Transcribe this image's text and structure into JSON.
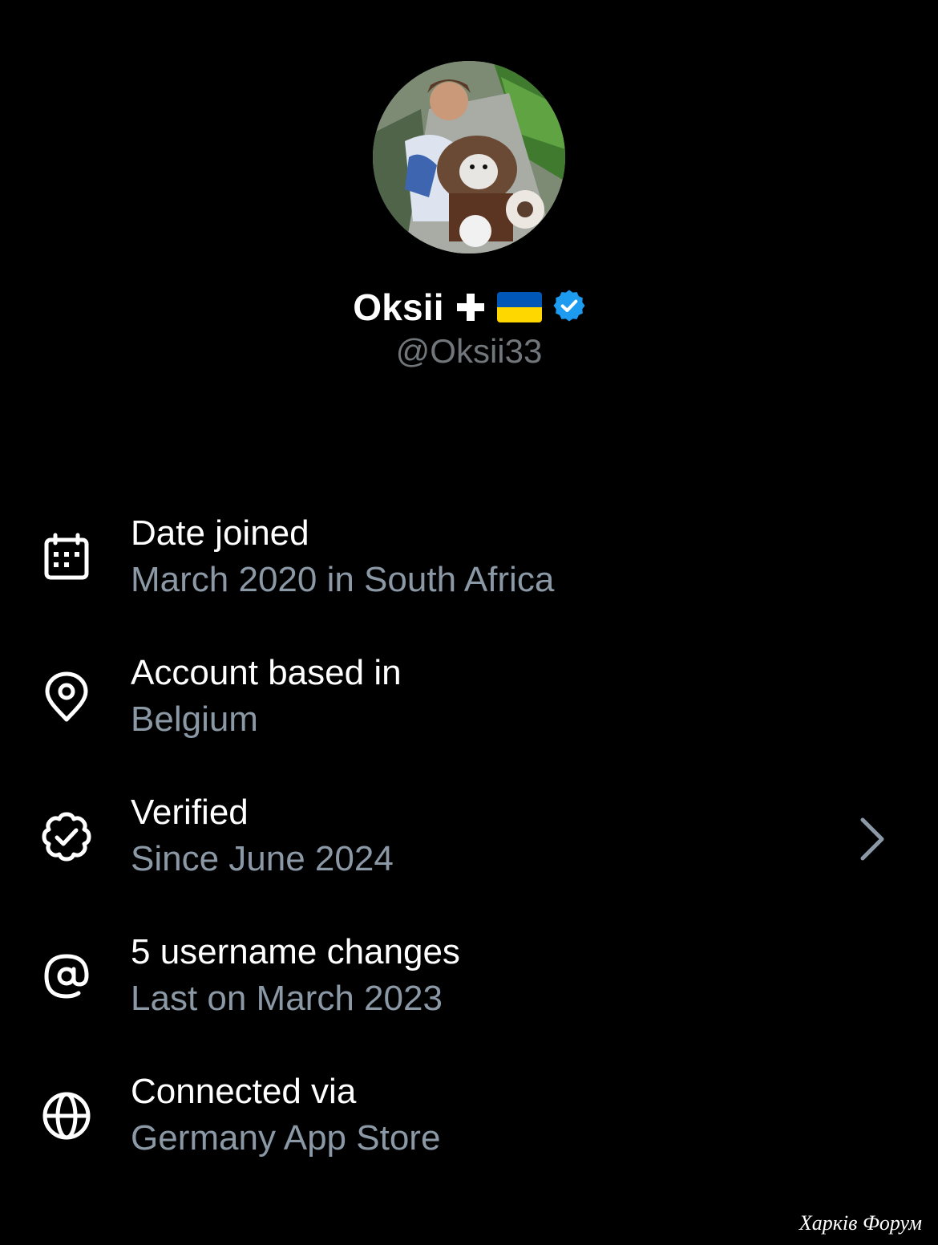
{
  "profile": {
    "avatar_alt": "Profile photo",
    "display_name": "Oksii",
    "handle": "@Oksii33",
    "name_icons": [
      "cross-icon",
      "ukraine-flag-icon",
      "verified-badge-icon"
    ],
    "verified_color": "#1d9bf0"
  },
  "about": {
    "items": [
      {
        "icon": "calendar-icon",
        "title": "Date joined",
        "subtitle": "March 2020 in South Africa"
      },
      {
        "icon": "location-pin-icon",
        "title": "Account based in",
        "subtitle": "Belgium"
      },
      {
        "icon": "verified-seal-icon",
        "title": "Verified",
        "subtitle": "Since June 2024",
        "has_chevron": true
      },
      {
        "icon": "at-sign-icon",
        "title": "5 username changes",
        "subtitle": "Last on March 2023"
      },
      {
        "icon": "globe-icon",
        "title": "Connected via",
        "subtitle": "Germany App Store"
      }
    ]
  },
  "watermark": "Харків Форум",
  "colors": {
    "background": "#000000",
    "primary_text": "#ffffff",
    "secondary_text": "#8b98a5",
    "handle_text": "#71767b"
  }
}
